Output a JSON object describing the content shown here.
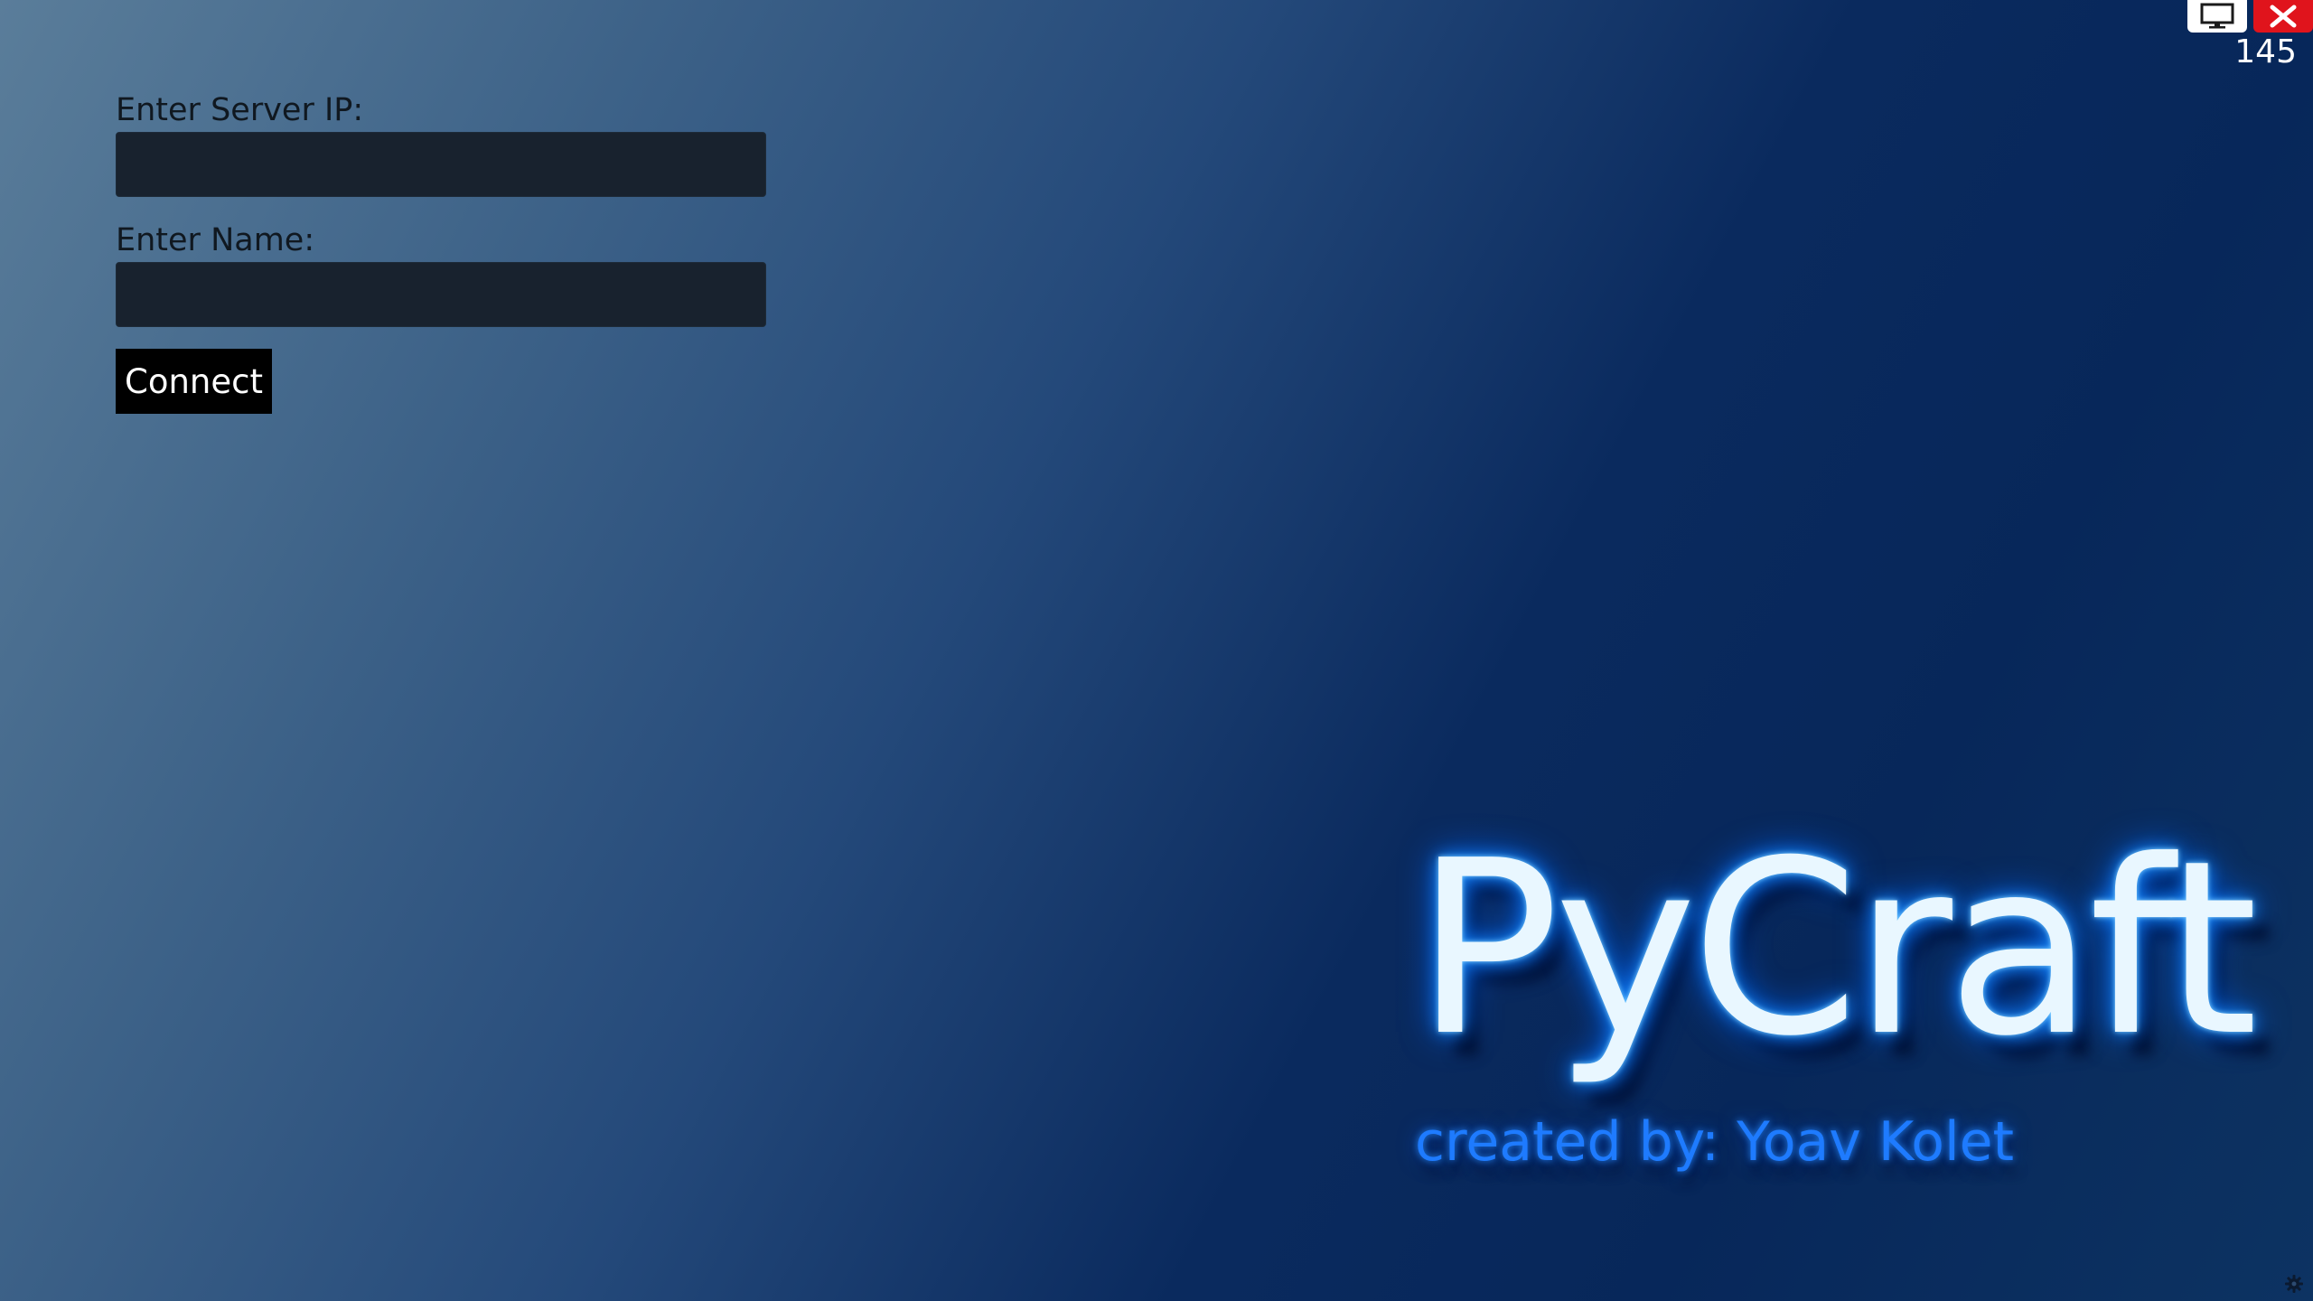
{
  "form": {
    "server_ip_label": "Enter Server IP:",
    "server_ip_value": "",
    "name_label": "Enter Name:",
    "name_value": "",
    "connect_label": "Connect"
  },
  "window_controls": {
    "fullscreen_icon": "monitor-icon",
    "close_icon": "close-icon",
    "close_color": "#e0141c",
    "fps": "145"
  },
  "logo": {
    "title": "PyCraft",
    "credit": "created by: Yoav Kolet",
    "glow_color": "#1a8cff"
  },
  "footer": {
    "settings_icon": "gear-icon"
  }
}
